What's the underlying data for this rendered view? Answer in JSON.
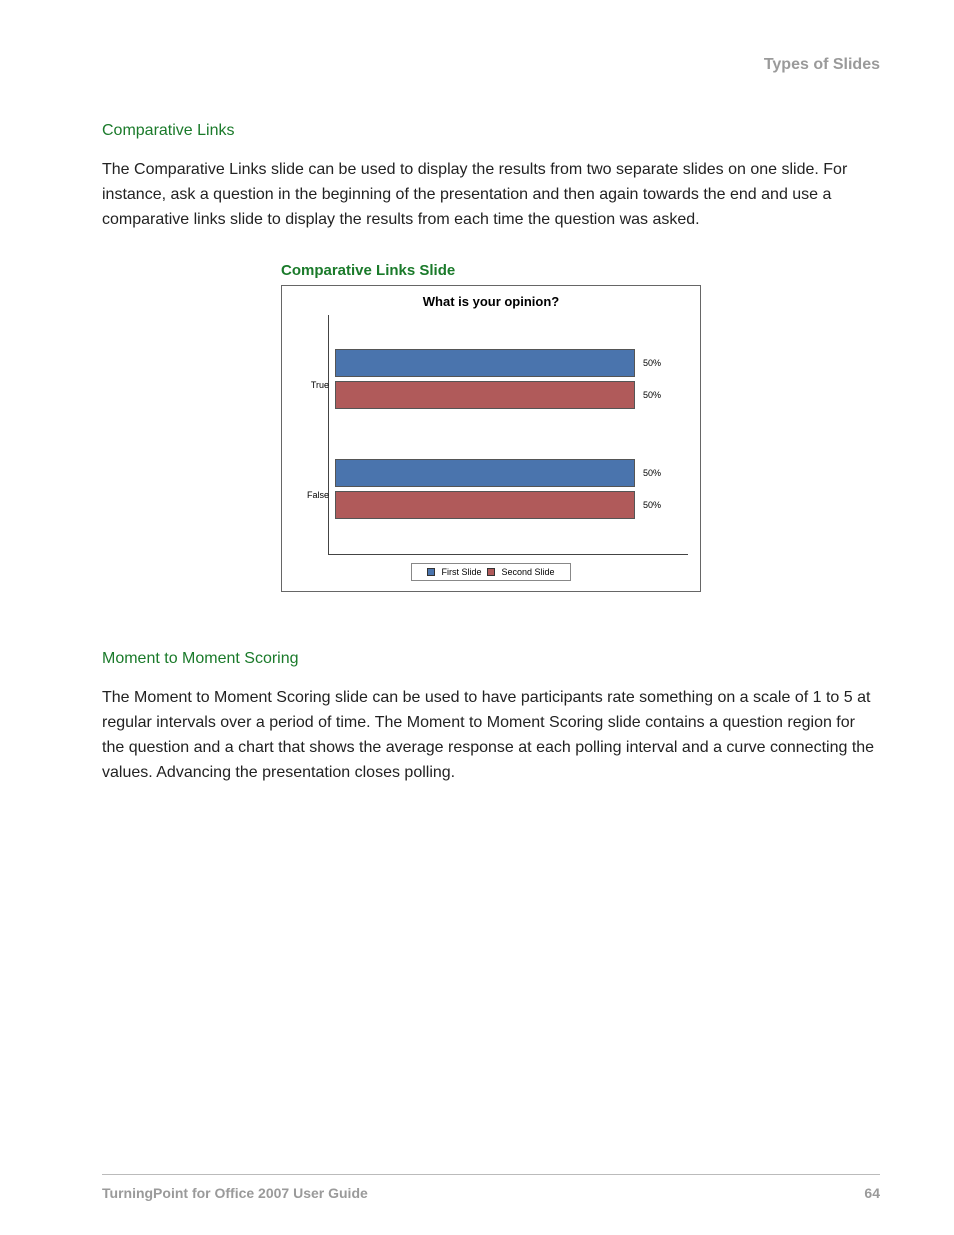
{
  "header": {
    "section_title": "Types of Slides"
  },
  "sections": {
    "comparative": {
      "heading": "Comparative Links",
      "body": "The Comparative Links slide can be used to display the results from two separate slides on one slide. For instance, ask a question in the beginning of the presentation and then again towards the end and use a comparative links slide to display the results from each time the question was asked."
    },
    "figure": {
      "caption": "Comparative Links Slide"
    },
    "moment": {
      "heading": "Moment to Moment Scoring",
      "body": "The Moment to Moment Scoring slide can be used to have participants rate something on a scale of 1 to 5 at regular intervals over a period of time. The Moment to Moment Scoring slide contains a question region for the question and a chart that shows the average response at each polling interval and a curve connecting the values. Advancing the presentation closes polling."
    }
  },
  "chart_data": {
    "type": "bar",
    "orientation": "horizontal",
    "title": "What is your opinion?",
    "categories": [
      "True",
      "False"
    ],
    "series": [
      {
        "name": "First Slide",
        "color": "#4a74ad",
        "values": [
          50,
          50
        ]
      },
      {
        "name": "Second Slide",
        "color": "#b05a5a",
        "values": [
          50,
          50
        ]
      }
    ],
    "value_suffix": "%",
    "xlim": [
      0,
      100
    ],
    "legend_labels": {
      "first": "First Slide",
      "second": "Second Slide"
    },
    "value_labels": {
      "true_first": "50%",
      "true_second": "50%",
      "false_first": "50%",
      "false_second": "50%"
    }
  },
  "footer": {
    "doc_title": "TurningPoint for Office 2007 User Guide",
    "page_number": "64"
  }
}
